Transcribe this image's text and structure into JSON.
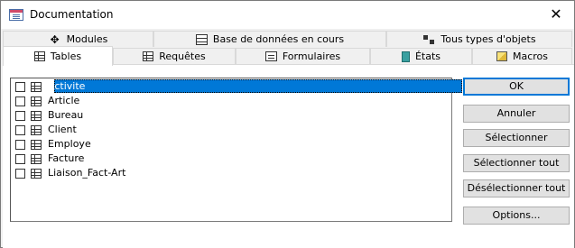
{
  "window": {
    "title": "Documentation"
  },
  "tabs": {
    "top_row": [
      {
        "label": "Modules",
        "icon": "module-icon"
      },
      {
        "label": "Base de données en cours",
        "icon": "database-icon"
      },
      {
        "label": "Tous types d'objets",
        "icon": "all-objects-icon"
      }
    ],
    "bottom_row": [
      {
        "label": "Tables",
        "icon": "table-icon",
        "active": true
      },
      {
        "label": "Requêtes",
        "icon": "query-icon"
      },
      {
        "label": "Formulaires",
        "icon": "form-icon"
      },
      {
        "label": "États",
        "icon": "report-icon"
      },
      {
        "label": "Macros",
        "icon": "macro-icon"
      }
    ]
  },
  "list": {
    "items": [
      {
        "label": "Activite",
        "checked": false,
        "selected": true
      },
      {
        "label": "Article",
        "checked": false
      },
      {
        "label": "Bureau",
        "checked": false
      },
      {
        "label": "Client",
        "checked": false
      },
      {
        "label": "Employe",
        "checked": false
      },
      {
        "label": "Facture",
        "checked": false
      },
      {
        "label": "Liaison_Fact-Art",
        "checked": false
      }
    ]
  },
  "buttons": {
    "ok": "OK",
    "cancel": "Annuler",
    "select": "Sélectionner",
    "select_all": "Sélectionner tout",
    "deselect_all": "Désélectionner tout",
    "options": "Options..."
  },
  "colors": {
    "selection": "#0078d7",
    "default_button_border": "#0078d7"
  }
}
